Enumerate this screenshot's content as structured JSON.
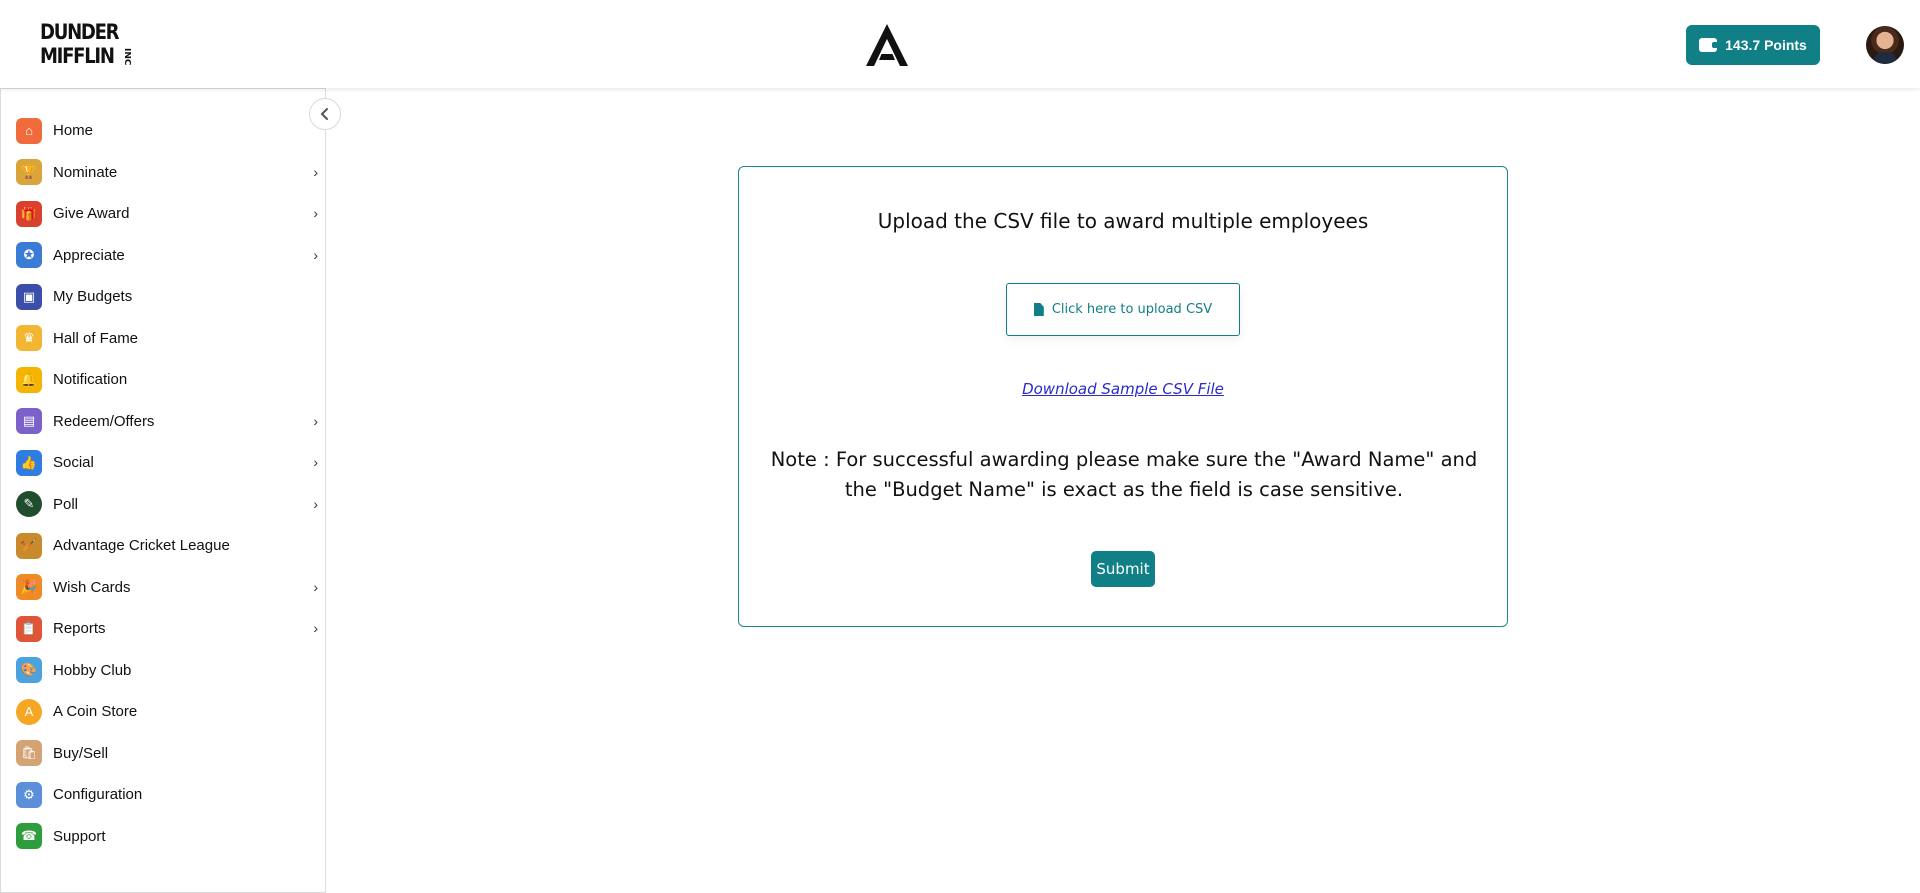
{
  "header": {
    "brand_logo_lines": [
      "DUNDER",
      "MIFFLIN"
    ],
    "brand_logo_suffix": "INC",
    "center_logo": "advantage-a-logo",
    "points_label": "143.7  Points",
    "points_icon": "wallet-icon",
    "avatar": "user-avatar"
  },
  "sidebar": {
    "collapse_icon": "chevron-left-icon",
    "items": [
      {
        "label": "Home",
        "icon": "home-icon",
        "color": "#e8542b",
        "has_submenu": false
      },
      {
        "label": "Nominate",
        "icon": "trophy-icon",
        "color": "#c9902a",
        "has_submenu": true
      },
      {
        "label": "Give Award",
        "icon": "gift-icon",
        "color": "#d9412e",
        "has_submenu": true
      },
      {
        "label": "Appreciate",
        "icon": "medal-icon",
        "color": "#3a7bd5",
        "has_submenu": true
      },
      {
        "label": "My Budgets",
        "icon": "wallet-icon",
        "color": "#3c4fa8",
        "has_submenu": false
      },
      {
        "label": "Hall of Fame",
        "icon": "crown-icon",
        "color": "#f2b632",
        "has_submenu": false
      },
      {
        "label": "Notification",
        "icon": "bell-icon",
        "color": "#f4b400",
        "has_submenu": false
      },
      {
        "label": "Redeem/Offers",
        "icon": "coupon-icon",
        "color": "#7b61c9",
        "has_submenu": true
      },
      {
        "label": "Social",
        "icon": "social-icon",
        "color": "#2f7de1",
        "has_submenu": true
      },
      {
        "label": "Poll",
        "icon": "poll-icon",
        "color": "#1f4d2e",
        "has_submenu": true
      },
      {
        "label": "Advantage Cricket League",
        "icon": "cricket-icon",
        "color": "#c98a2b",
        "has_submenu": false
      },
      {
        "label": "Wish Cards",
        "icon": "party-popper-icon",
        "color": "#f08a24",
        "has_submenu": true
      },
      {
        "label": "Reports",
        "icon": "clipboard-icon",
        "color": "#e0553a",
        "has_submenu": true
      },
      {
        "label": "Hobby Club",
        "icon": "palette-icon",
        "color": "#4aa3df",
        "has_submenu": false
      },
      {
        "label": "A Coin Store",
        "icon": "coin-icon",
        "color": "#f5a623",
        "has_submenu": false
      },
      {
        "label": "Buy/Sell",
        "icon": "shopping-bag-icon",
        "color": "#d4a373",
        "has_submenu": false
      },
      {
        "label": "Configuration",
        "icon": "config-icon",
        "color": "#5b8fd9",
        "has_submenu": false
      },
      {
        "label": "Support",
        "icon": "phone-icon",
        "color": "#2e9d3e",
        "has_submenu": false
      }
    ],
    "submenu_icon": "chevron-right-icon"
  },
  "main": {
    "title": "Upload the CSV file to award multiple employees",
    "upload_label": "Click here to upload CSV",
    "upload_icon": "file-icon",
    "download_link": "Download Sample CSV File",
    "note": "Note : For successful awarding please make sure the \"Award Name\" and the \"Budget Name\" is exact as the field is case sensitive.",
    "submit_label": "Submit"
  },
  "colors": {
    "accent": "#107f86",
    "link": "#2a2ac8",
    "card_border": "#1a8a90"
  }
}
